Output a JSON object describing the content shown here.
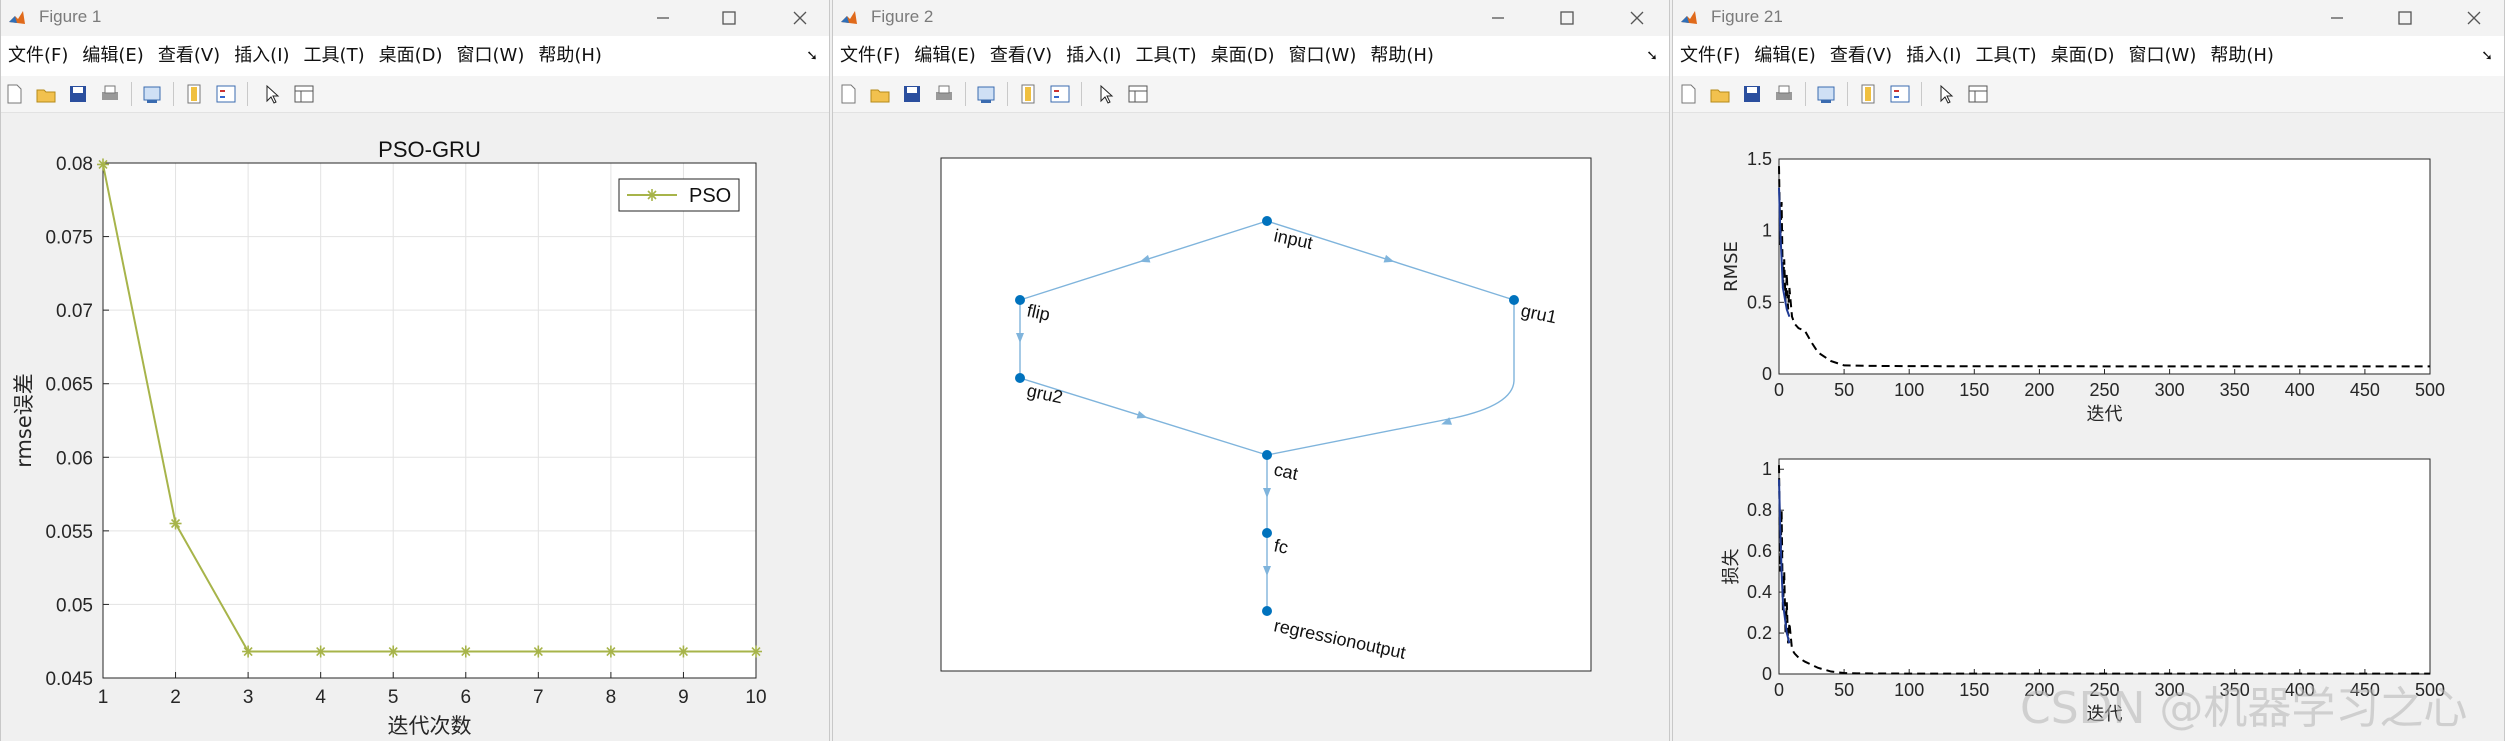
{
  "menu": [
    "文件(F)",
    "编辑(E)",
    "查看(V)",
    "插入(I)",
    "工具(T)",
    "桌面(D)",
    "窗口(W)",
    "帮助(H)"
  ],
  "win1": {
    "title": "Figure 1",
    "chart_data": {
      "type": "line",
      "title": "PSO-GRU",
      "xlabel": "迭代次数",
      "ylabel": "rmse误差",
      "xlim": [
        1,
        10
      ],
      "ylim": [
        0.045,
        0.08
      ],
      "grid": true,
      "legend_position": "top-right",
      "x_ticks": [
        "1",
        "2",
        "3",
        "4",
        "5",
        "6",
        "7",
        "8",
        "9",
        "10"
      ],
      "y_ticks": [
        "0.045",
        "0.05",
        "0.055",
        "0.06",
        "0.065",
        "0.07",
        "0.075",
        "0.08"
      ],
      "series": [
        {
          "name": "PSO",
          "color": "#a7b44a",
          "x": [
            1,
            2,
            3,
            4,
            5,
            6,
            7,
            8,
            9,
            10
          ],
          "y": [
            0.0799,
            0.0555,
            0.0468,
            0.0468,
            0.0468,
            0.0468,
            0.0468,
            0.0468,
            0.0468,
            0.0468
          ]
        }
      ]
    }
  },
  "win2": {
    "title": "Figure 2",
    "graph": {
      "nodes": [
        {
          "id": "input",
          "label": "input"
        },
        {
          "id": "flip",
          "label": "flip"
        },
        {
          "id": "gru1",
          "label": "gru1"
        },
        {
          "id": "gru2",
          "label": "gru2"
        },
        {
          "id": "cat",
          "label": "cat"
        },
        {
          "id": "fc",
          "label": "fc"
        },
        {
          "id": "regressionoutput",
          "label": "regressionoutput"
        }
      ],
      "edges": [
        [
          "input",
          "flip"
        ],
        [
          "input",
          "gru1"
        ],
        [
          "flip",
          "gru2"
        ],
        [
          "gru2",
          "cat"
        ],
        [
          "gru1",
          "cat"
        ],
        [
          "cat",
          "fc"
        ],
        [
          "fc",
          "regressionoutput"
        ]
      ],
      "node_color": "#0072bd",
      "edge_color": "#7fb4dc"
    }
  },
  "win3": {
    "title": "Figure 21",
    "chart_data": [
      {
        "type": "line",
        "xlabel": "迭代",
        "ylabel": "RMSE",
        "xlim": [
          0,
          500
        ],
        "ylim": [
          0,
          1.5
        ],
        "x_ticks": [
          "0",
          "50",
          "100",
          "150",
          "200",
          "250",
          "300",
          "350",
          "400",
          "450",
          "500"
        ],
        "y_ticks": [
          "0",
          "0.5",
          "1",
          "1.5"
        ],
        "series": [
          {
            "color": "#000000",
            "style": "dashed",
            "x": [
              0,
              1,
              2,
              3,
              4,
              5,
              6,
              7,
              8,
              10,
              12,
              15,
              20,
              25,
              30,
              40,
              50,
              60,
              80,
              100,
              150,
              200,
              300,
              400,
              500
            ],
            "y": [
              1.45,
              0.9,
              1.2,
              0.6,
              0.8,
              0.5,
              0.7,
              0.45,
              0.6,
              0.4,
              0.35,
              0.32,
              0.3,
              0.22,
              0.15,
              0.09,
              0.06,
              0.058,
              0.056,
              0.055,
              0.054,
              0.054,
              0.053,
              0.053,
              0.053
            ]
          },
          {
            "color": "#1f3a93",
            "style": "solid",
            "x": [
              0,
              1,
              2,
              3,
              4,
              5,
              6,
              8
            ],
            "y": [
              1.3,
              1.0,
              0.8,
              0.6,
              0.55,
              0.5,
              0.45,
              0.4
            ]
          }
        ]
      },
      {
        "type": "line",
        "xlabel": "迭代",
        "ylabel": "损失",
        "xlim": [
          0,
          500
        ],
        "ylim": [
          0,
          1.05
        ],
        "x_ticks": [
          "0",
          "50",
          "100",
          "150",
          "200",
          "250",
          "300",
          "350",
          "400",
          "450",
          "500"
        ],
        "y_ticks": [
          "0",
          "0.2",
          "0.4",
          "0.6",
          "0.8",
          "1"
        ],
        "series": [
          {
            "color": "#000000",
            "style": "dashed",
            "x": [
              0,
              1,
              2,
              3,
              4,
              5,
              6,
              7,
              8,
              10,
              12,
              15,
              20,
              30,
              40,
              50,
              60,
              100,
              200,
              300,
              400,
              500
            ],
            "y": [
              1.02,
              0.5,
              0.8,
              0.3,
              0.5,
              0.2,
              0.35,
              0.15,
              0.25,
              0.12,
              0.1,
              0.08,
              0.06,
              0.03,
              0.012,
              0.005,
              0.003,
              0.002,
              0.002,
              0.002,
              0.002,
              0.002
            ]
          },
          {
            "color": "#1f3a93",
            "style": "solid",
            "x": [
              0,
              1,
              2,
              3,
              4,
              5,
              6,
              8
            ],
            "y": [
              0.95,
              0.7,
              0.5,
              0.35,
              0.3,
              0.25,
              0.2,
              0.15
            ]
          }
        ]
      }
    ]
  },
  "watermark": "CSDN @机器学习之心"
}
